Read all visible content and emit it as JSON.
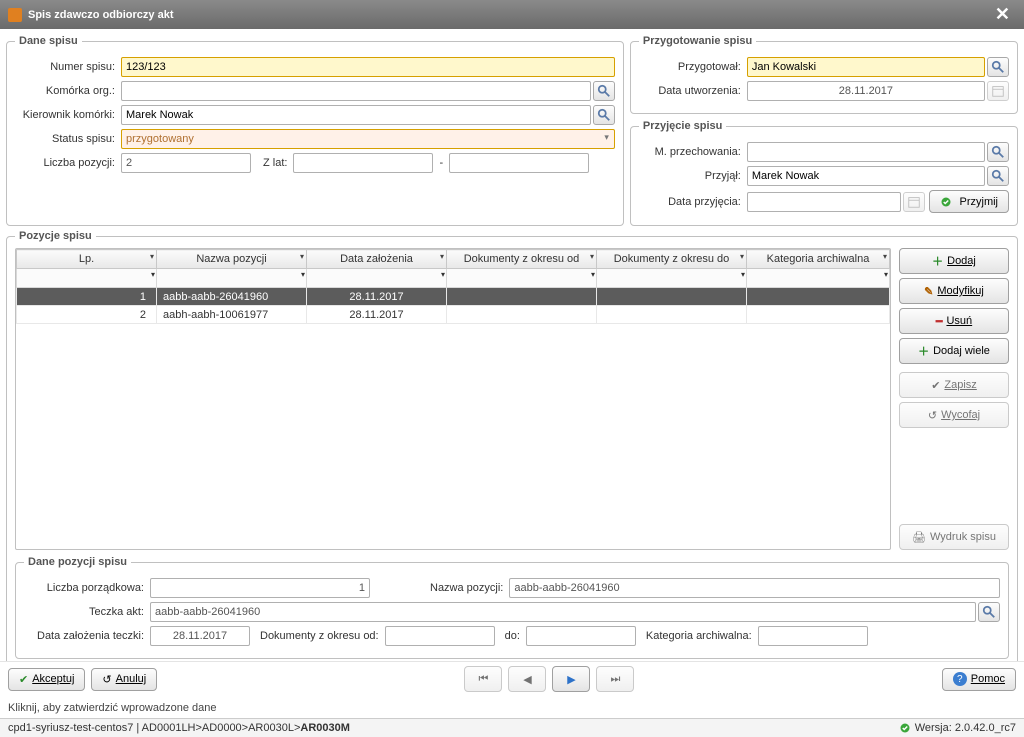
{
  "window": {
    "title": "Spis zdawczo odbiorczy akt"
  },
  "dane_spisu": {
    "legend": "Dane spisu",
    "numer_spisu_lbl": "Numer spisu:",
    "numer_spisu": "123/123",
    "komorka_lbl": "Komórka org.:",
    "komorka": "",
    "kierownik_lbl": "Kierownik komórki:",
    "kierownik": "Marek Nowak",
    "status_lbl": "Status spisu:",
    "status": "przygotowany",
    "liczba_lbl": "Liczba pozycji:",
    "liczba": "2",
    "zlat_lbl": "Z lat:",
    "zlat_sep": "-",
    "zlat_from": "",
    "zlat_to": ""
  },
  "przygotowanie": {
    "legend": "Przygotowanie spisu",
    "przygotowal_lbl": "Przygotował:",
    "przygotowal": "Jan Kowalski",
    "data_utw_lbl": "Data utworzenia:",
    "data_utw": "28.11.2017"
  },
  "przyjecie": {
    "legend": "Przyjęcie spisu",
    "mprzech_lbl": "M. przechowania:",
    "mprzech": "",
    "przyjal_lbl": "Przyjął:",
    "przyjal": "Marek Nowak",
    "data_prz_lbl": "Data przyjęcia:",
    "data_prz": "",
    "przyjmij_lbl": "Przyjmij"
  },
  "pozycje": {
    "legend": "Pozycje spisu",
    "headers": [
      "Lp.",
      "Nazwa pozycji",
      "Data założenia",
      "Dokumenty z okresu od",
      "Dokumenty z okresu do",
      "Kategoria archiwalna"
    ],
    "rows": [
      {
        "lp": "1",
        "nazwa": "aabb-aabb-26041960",
        "data": "28.11.2017",
        "od": "",
        "do": "",
        "kat": ""
      },
      {
        "lp": "2",
        "nazwa": "aabh-aabh-10061977",
        "data": "28.11.2017",
        "od": "",
        "do": "",
        "kat": ""
      }
    ],
    "selected_index": 0,
    "btn_dodaj": "Dodaj",
    "btn_modyfikuj": "Modyfikuj",
    "btn_usun": "Usuń",
    "btn_dodaj_wiele": "Dodaj wiele",
    "btn_zapisz": "Zapisz",
    "btn_wycofaj": "Wycofaj",
    "btn_wydruk": "Wydruk spisu"
  },
  "dane_pozycji": {
    "legend": "Dane pozycji spisu",
    "lp_lbl": "Liczba porządkowa:",
    "lp": "1",
    "nazwa_lbl": "Nazwa pozycji:",
    "nazwa": "aabb-aabb-26041960",
    "teczka_lbl": "Teczka akt:",
    "teczka": "aabb-aabb-26041960",
    "data_lbl": "Data założenia teczki:",
    "data": "28.11.2017",
    "od_lbl": "Dokumenty z okresu od:",
    "od": "",
    "do_lbl": "do:",
    "do": "",
    "kat_lbl": "Kategoria archiwalna:",
    "kat": ""
  },
  "bottom": {
    "akceptuj": "Akceptuj",
    "anuluj": "Anuluj",
    "pomoc": "Pomoc"
  },
  "status_hint": "Kliknij, aby zatwierdzić wprowadzone dane",
  "footer": {
    "path_prefix": "cpd1-syriusz-test-centos7 | AD0001LH>AD0000>AR0030L>",
    "path_bold": "AR0030M",
    "version_lbl": "Wersja: 2.0.42.0_rc7"
  }
}
